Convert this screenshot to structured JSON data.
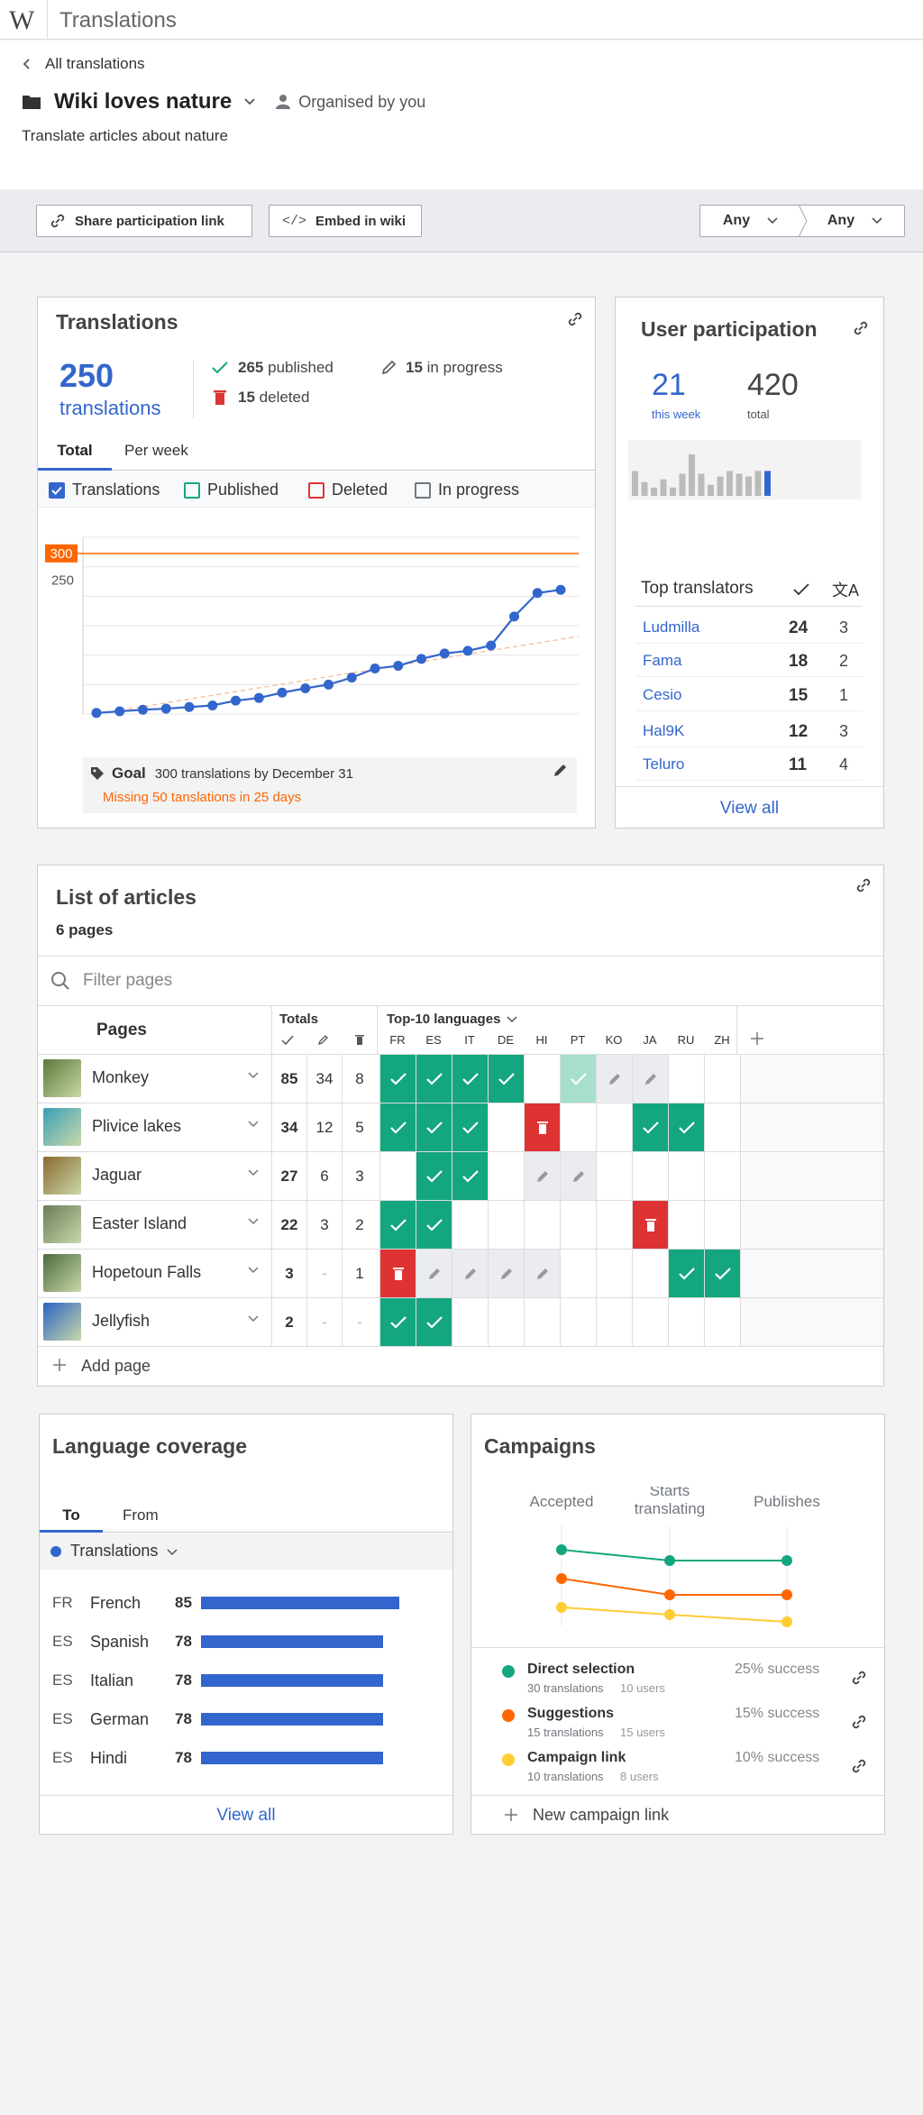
{
  "app": {
    "title": "Translations"
  },
  "header": {
    "back_label": "All translations",
    "campaign_name": "Wiki loves nature",
    "organiser": "Organised by you",
    "description": "Translate articles about nature"
  },
  "toolbar": {
    "share_label": "Share participation link",
    "embed_label": "Embed in wiki",
    "filter1": "Any",
    "filter2": "Any"
  },
  "translations_card": {
    "title": "Translations",
    "total_number": "250",
    "total_label": "translations",
    "published_count": "265",
    "published_label": "published",
    "in_progress_count": "15",
    "in_progress_label": "in progress",
    "deleted_count": "15",
    "deleted_label": "deleted",
    "tabs": [
      "Total",
      "Per week"
    ],
    "filters": [
      {
        "label": "Translations",
        "checked": true,
        "color": "#36c"
      },
      {
        "label": "Published",
        "checked": false,
        "color": "#14a67e"
      },
      {
        "label": "Deleted",
        "checked": false,
        "color": "#d33"
      },
      {
        "label": "In progress",
        "checked": false,
        "color": "#72777d"
      }
    ],
    "goal_label": "Goal",
    "goal_text": "300 translations by December 31",
    "goal_warning": "Missing 50 tanslations in 25 days"
  },
  "chart_data": {
    "type": "line",
    "series": [
      {
        "values": [
          2,
          5,
          8,
          10,
          13,
          16,
          25,
          30,
          40,
          48,
          55,
          68,
          85,
          90,
          103,
          113,
          118,
          128,
          182,
          226,
          232
        ]
      }
    ],
    "goal_line": 300,
    "goal_label": "300",
    "y_ticks": [
      "250"
    ],
    "ylim": [
      0,
      330
    ],
    "colors": {
      "line": "#36c",
      "goal": "#f60",
      "trend": "#f9b48a"
    }
  },
  "user_participation": {
    "title": "User participation",
    "week_count": "21",
    "week_label": "this week",
    "total_count": "420",
    "total_label": "total",
    "spark": [
      9,
      5,
      3,
      6,
      3,
      8,
      15,
      8,
      4,
      7,
      9,
      8,
      7,
      9,
      9
    ],
    "top_title": "Top translators",
    "translators": [
      {
        "name": "Ludmilla",
        "published": "24",
        "translated": "3"
      },
      {
        "name": "Fama",
        "published": "18",
        "translated": "2"
      },
      {
        "name": "Cesio",
        "published": "15",
        "translated": "1"
      },
      {
        "name": "Hal9K",
        "published": "12",
        "translated": "3"
      },
      {
        "name": "Teluro",
        "published": "11",
        "translated": "4"
      }
    ],
    "view_all": "View all"
  },
  "articles": {
    "title": "List of articles",
    "subtitle": "6 pages",
    "filter_placeholder": "Filter pages",
    "col_pages": "Pages",
    "col_totals": "Totals",
    "col_languages": "Top-10 languages",
    "languages": [
      "FR",
      "ES",
      "IT",
      "DE",
      "HI",
      "PT",
      "KO",
      "JA",
      "RU",
      "ZH"
    ],
    "rows": [
      {
        "name": "Monkey",
        "t": "85",
        "p": "34",
        "d": "8",
        "cells": [
          "g",
          "g",
          "g",
          "g",
          "",
          "lg",
          "grp",
          "grp",
          "",
          ""
        ],
        "thumb": "#5c7a3a"
      },
      {
        "name": "Plivice lakes",
        "t": "34",
        "p": "12",
        "d": "5",
        "cells": [
          "g",
          "g",
          "g",
          "",
          "rd",
          "",
          "",
          "g",
          "g",
          ""
        ],
        "thumb": "#3aa0b8"
      },
      {
        "name": "Jaguar",
        "t": "27",
        "p": "6",
        "d": "3",
        "cells": [
          "",
          "g",
          "g",
          "",
          "grp",
          "grp",
          "",
          "",
          "",
          ""
        ],
        "thumb": "#8a6a30"
      },
      {
        "name": "Easter Island",
        "t": "22",
        "p": "3",
        "d": "2",
        "cells": [
          "g",
          "g",
          "",
          "",
          "",
          "",
          "",
          "rd",
          "",
          ""
        ],
        "thumb": "#6a7d5a"
      },
      {
        "name": "Hopetoun Falls",
        "t": "3",
        "p": "-",
        "d": "1",
        "cells": [
          "rd",
          "grp",
          "grp",
          "grp",
          "grp",
          "",
          "",
          "",
          "g",
          "g"
        ],
        "thumb": "#4a6b3e"
      },
      {
        "name": "Jellyfish",
        "t": "2",
        "p": "-",
        "d": "-",
        "cells": [
          "g",
          "g",
          "",
          "",
          "",
          "",
          "",
          "",
          "",
          ""
        ],
        "thumb": "#2a63c4"
      }
    ],
    "add_page": "Add page"
  },
  "language_coverage": {
    "title": "Language coverage",
    "tabs": [
      "To",
      "From"
    ],
    "dropdown": "Translations",
    "rows": [
      {
        "code": "FR",
        "name": "French",
        "value": "85",
        "n": 85
      },
      {
        "code": "ES",
        "name": "Spanish",
        "value": "78",
        "n": 78
      },
      {
        "code": "ES",
        "name": "Italian",
        "value": "78",
        "n": 78
      },
      {
        "code": "ES",
        "name": "German",
        "value": "78",
        "n": 78
      },
      {
        "code": "ES",
        "name": "Hindi",
        "value": "78",
        "n": 78
      }
    ],
    "view_all": "View all"
  },
  "campaigns": {
    "title": "Campaigns",
    "stages": [
      "Accepted",
      "Starts\ntranslating",
      "Publishes"
    ],
    "items": [
      {
        "name": "Direct selection",
        "sub1": "30 translations",
        "sub2": "10 users",
        "success": "25% success",
        "color": "#14a67e"
      },
      {
        "name": "Suggestions",
        "sub1": "15 translations",
        "sub2": "15 users",
        "success": "15% success",
        "color": "#f60"
      },
      {
        "name": "Campaign link",
        "sub1": "10 translations",
        "sub2": "8 users",
        "success": "10% success",
        "color": "#fc3"
      }
    ],
    "new_link": "New campaign link"
  }
}
